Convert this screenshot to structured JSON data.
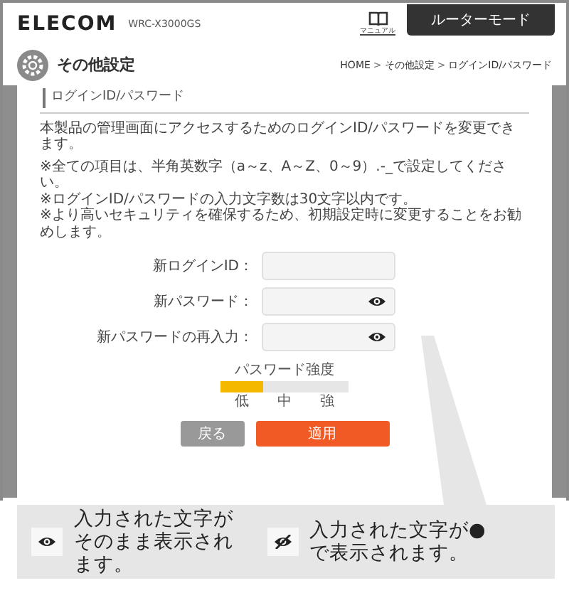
{
  "header": {
    "logo": "ELECOM",
    "model": "WRC-X3000GS",
    "manual_label": "マニュアル",
    "mode_tab": "ルーターモード"
  },
  "page": {
    "title": "その他設定",
    "breadcrumb": [
      {
        "label": "HOME",
        "kind": "link"
      },
      {
        "label": ">",
        "kind": "separator"
      },
      {
        "label": "その他設定",
        "kind": "link"
      },
      {
        "label": ">",
        "kind": "separator"
      },
      {
        "label": "ログインID/パスワード",
        "kind": "current"
      }
    ]
  },
  "section_title": "ログインID/パスワード",
  "description": "本製品の管理画面にアクセスするためのログインID/パスワードを変更できます。",
  "notes": [
    "※全ての項目は、半角英数字（a～z、A～Z、0～9）.-_で設定してください。",
    "※ログインID/パスワードの入力文字数は30文字以内です。",
    "※より高いセキュリティを確保するため、初期設定時に変更することをお勧めします。"
  ],
  "fields": [
    {
      "label": "新ログインID：",
      "kind": "text"
    },
    {
      "label": "新パスワード：",
      "kind": "password"
    },
    {
      "label": "新パスワードの再入力：",
      "kind": "password"
    }
  ],
  "strength": {
    "label": "パスワード強度",
    "level": 0.33,
    "steps": [
      "低",
      "中",
      "強"
    ]
  },
  "buttons": [
    {
      "label": "戻る",
      "kind": "secondary"
    },
    {
      "label": "適用",
      "kind": "primary"
    }
  ],
  "callout": {
    "items": [
      {
        "kind": "visible",
        "text": "入力された文字がそのまま表示されます。"
      },
      {
        "kind": "hidden",
        "text": "入力された文字が●で表示されます。"
      }
    ]
  }
}
